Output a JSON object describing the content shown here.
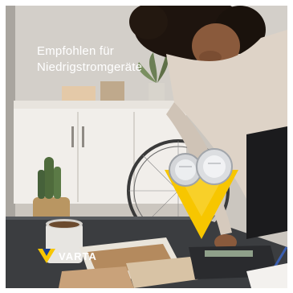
{
  "ad": {
    "headline_line1": "Empfohlen für",
    "headline_line2": "Niedrigstromgeräte",
    "brand_name": "VARTA"
  },
  "colors": {
    "brand_yellow": "#f7c600",
    "brand_blue": "#1c3f8f",
    "headline_text": "#ffffff"
  }
}
